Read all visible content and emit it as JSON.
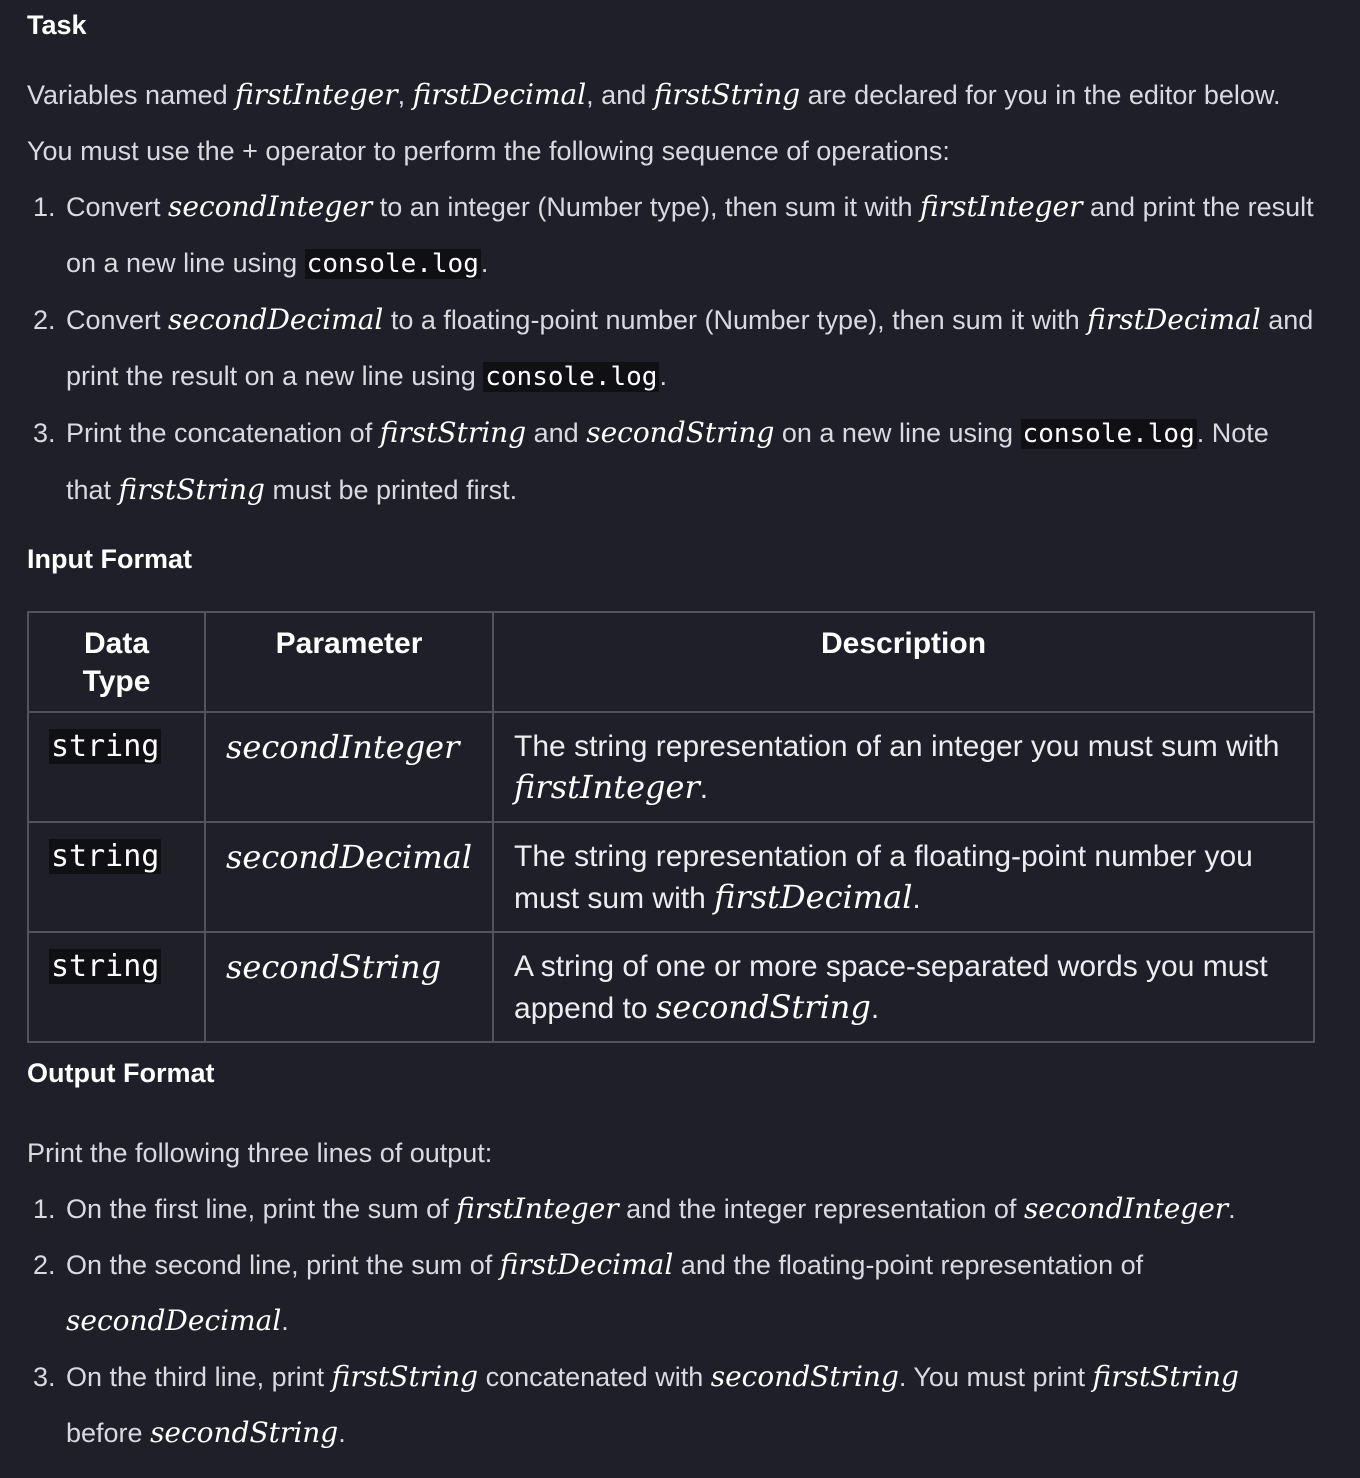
{
  "task": {
    "heading": "Task",
    "intro": {
      "t1": "Variables named ",
      "v1": "firstInteger",
      "t2": ", ",
      "v2": "firstDecimal",
      "t3": ", and ",
      "v3": "firstString",
      "t4": " are declared for you in the editor below. You must use the + operator to perform the following sequence of operations:"
    },
    "steps": [
      {
        "num": "1.",
        "t1": "Convert ",
        "v1": "secondInteger",
        "t2": " to an integer (Number type), then sum it with ",
        "v2": "firstInteger",
        "t3": " and print the result on a new line using ",
        "code": "console.log",
        "t4": "."
      },
      {
        "num": "2.",
        "t1": "Convert ",
        "v1": "secondDecimal",
        "t2": " to a floating-point number (Number type), then sum it with ",
        "v2": "firstDecimal",
        "t3": " and print the result on a new line using ",
        "code": "console.log",
        "t4": "."
      },
      {
        "num": "3.",
        "t1": "Print the concatenation of ",
        "v1": "firstString",
        "t2": " and ",
        "v2": "secondString",
        "t3": " on a new line using ",
        "code": "console.log",
        "t4": ". Note that ",
        "v3": "firstString",
        "t5": " must be printed first."
      }
    ]
  },
  "input_format": {
    "heading": "Input Format",
    "table": {
      "headers": [
        "Data Type",
        "Parameter",
        "Description"
      ],
      "rows": [
        {
          "type": "string",
          "param": "secondInteger",
          "desc_t1": "The string representation of an integer you must sum with ",
          "desc_v": "firstInteger",
          "desc_t2": "."
        },
        {
          "type": "string",
          "param": "secondDecimal",
          "desc_t1": "The string representation of a floating-point number you must sum with ",
          "desc_v": "firstDecimal",
          "desc_t2": "."
        },
        {
          "type": "string",
          "param": "secondString",
          "desc_t1": "A string of one or more space-separated words you must append to ",
          "desc_v": "secondString",
          "desc_t2": "."
        }
      ]
    }
  },
  "output_format": {
    "heading": "Output Format",
    "intro": "Print the following three lines of output:",
    "lines": [
      {
        "num": "1.",
        "t1": "On the first line, print the sum of ",
        "v1": "firstInteger",
        "t2": " and the integer representation of ",
        "v2": "secondInteger",
        "t3": "."
      },
      {
        "num": "2.",
        "t1": "On the second line, print the sum of ",
        "v1": "firstDecimal",
        "t2": " and the floating-point representation of ",
        "v2": "secondDecimal",
        "t3": "."
      },
      {
        "num": "3.",
        "t1": "On the third line, print ",
        "v1": "firstString",
        "t2": " concatenated with ",
        "v2": "secondString",
        "t3": ". You must print ",
        "v3": "firstString",
        "t4": " before ",
        "v4": "secondString",
        "t5": "."
      }
    ]
  }
}
